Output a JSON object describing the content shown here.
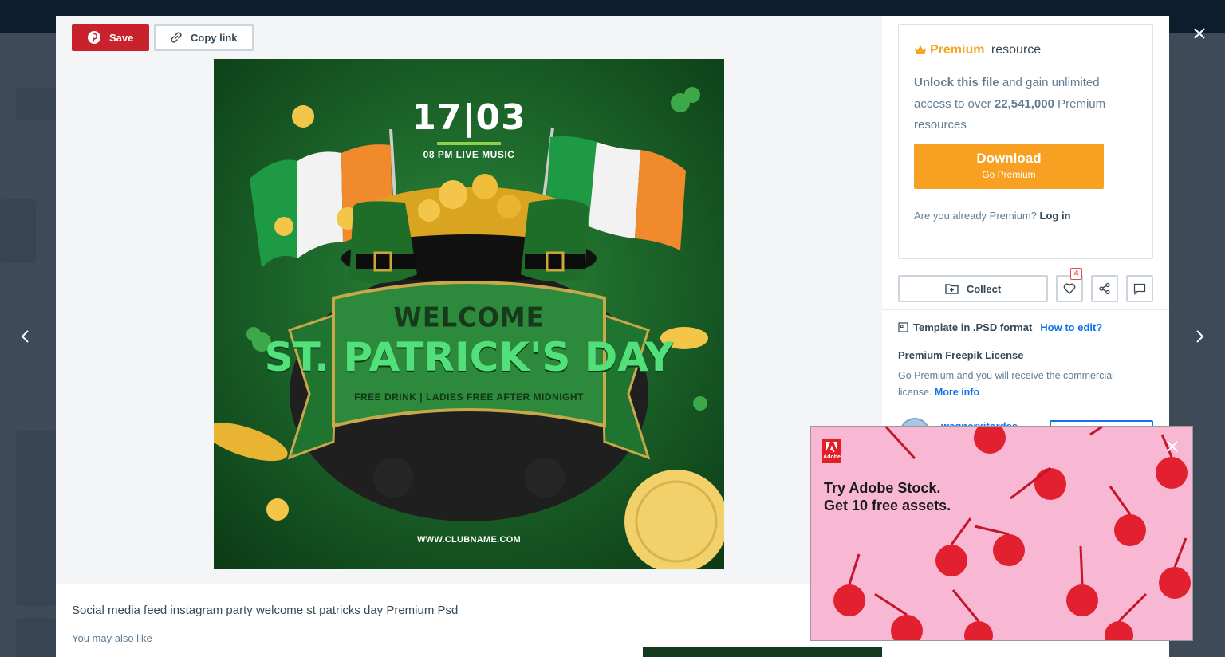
{
  "toolbar": {
    "save_label": "Save",
    "copy_link_label": "Copy link"
  },
  "poster": {
    "date": "17|03",
    "subtitle": "08 PM LIVE MUSIC",
    "welcome": "WELCOME",
    "title": "ST. PATRICK'S DAY",
    "tagline": "FREE DRINK | LADIES FREE AFTER MIDNIGHT",
    "url": "WWW.CLUBNAME.COM"
  },
  "resource": {
    "title": "Social media feed instagram party welcome st patricks day Premium Psd",
    "also_like": "You may also like"
  },
  "premium": {
    "heading_gold": "Premium",
    "heading_rest": " resource",
    "unlock_bold": "Unlock this file",
    "unlock_text": " and gain unlimited access to over ",
    "count_bold": "22,541,000",
    "count_text": " Premium resources",
    "download_label": "Download",
    "download_sub": "Go Premium",
    "already_text": "Are you already Premium? ",
    "login_label": "Log in"
  },
  "actions": {
    "collect_label": "Collect",
    "like_count": "4"
  },
  "template": {
    "label": "Template in .PSD format",
    "how_to_edit": "How to edit?"
  },
  "license": {
    "title": "Premium Freepik License",
    "text": "Go Premium and you will receive the commercial license. ",
    "more_info": "More info"
  },
  "author": {
    "name": "wagnerxitordes"
  },
  "ad": {
    "brand": "Adobe",
    "headline_line1": "Try Adobe Stock.",
    "headline_line2": "Get 10 free assets."
  },
  "colors": {
    "save_red": "#c8232c",
    "premium_gold": "#f5a623",
    "download_orange": "#f7a021",
    "link_blue": "#1273eb",
    "ad_pink": "#f8b8d4"
  }
}
